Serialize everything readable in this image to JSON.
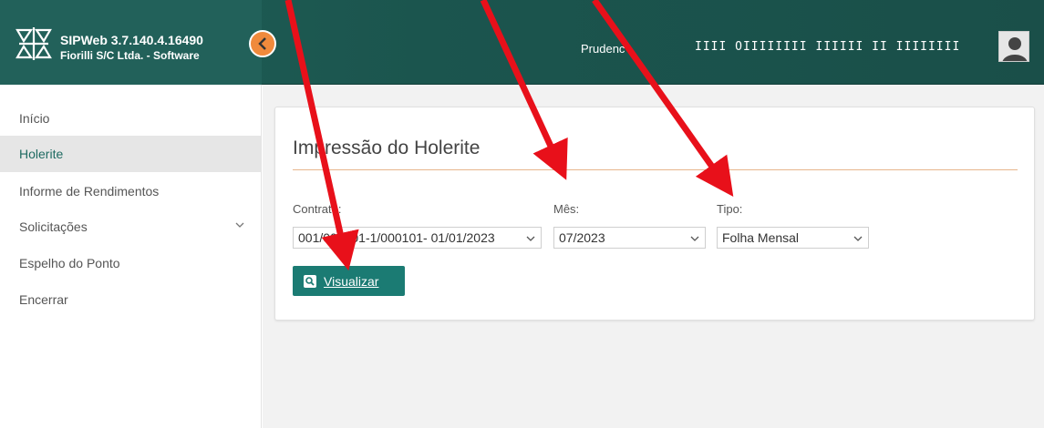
{
  "header": {
    "app_title": "SIPWeb 3.7.140.4.16490",
    "app_subtitle": "Fiorilli S/C Ltda. - Software",
    "user_name": "Prudenc",
    "entity_name": "IIII  OIIIIIIII IIIIII II IIIIIIII",
    "collapse_icon": "chevron-left-icon",
    "avatar_icon": "user-avatar-icon"
  },
  "sidebar": {
    "items": [
      {
        "label": "Início"
      },
      {
        "label": "Holerite"
      },
      {
        "label": "Informe de Rendimentos"
      },
      {
        "label": "Solicitações"
      },
      {
        "label": "Espelho do Ponto"
      },
      {
        "label": "Encerrar"
      }
    ],
    "active_index": 1
  },
  "main": {
    "title": "Impressão do Holerite",
    "contrato": {
      "label": "Contrato:",
      "value": "001/000101-1/000101- 01/01/2023"
    },
    "mes": {
      "label": "Mês:",
      "value": "07/2023"
    },
    "tipo": {
      "label": "Tipo:",
      "value": "Folha Mensal"
    },
    "view_button": {
      "label": "Visualizar",
      "icon": "search-icon"
    }
  },
  "colors": {
    "header_bg": "#1f5f57",
    "accent_orange": "#f08a3c",
    "button_teal": "#1b7b73",
    "active_text": "#1f6b62",
    "annotation_red": "#e8101a"
  }
}
